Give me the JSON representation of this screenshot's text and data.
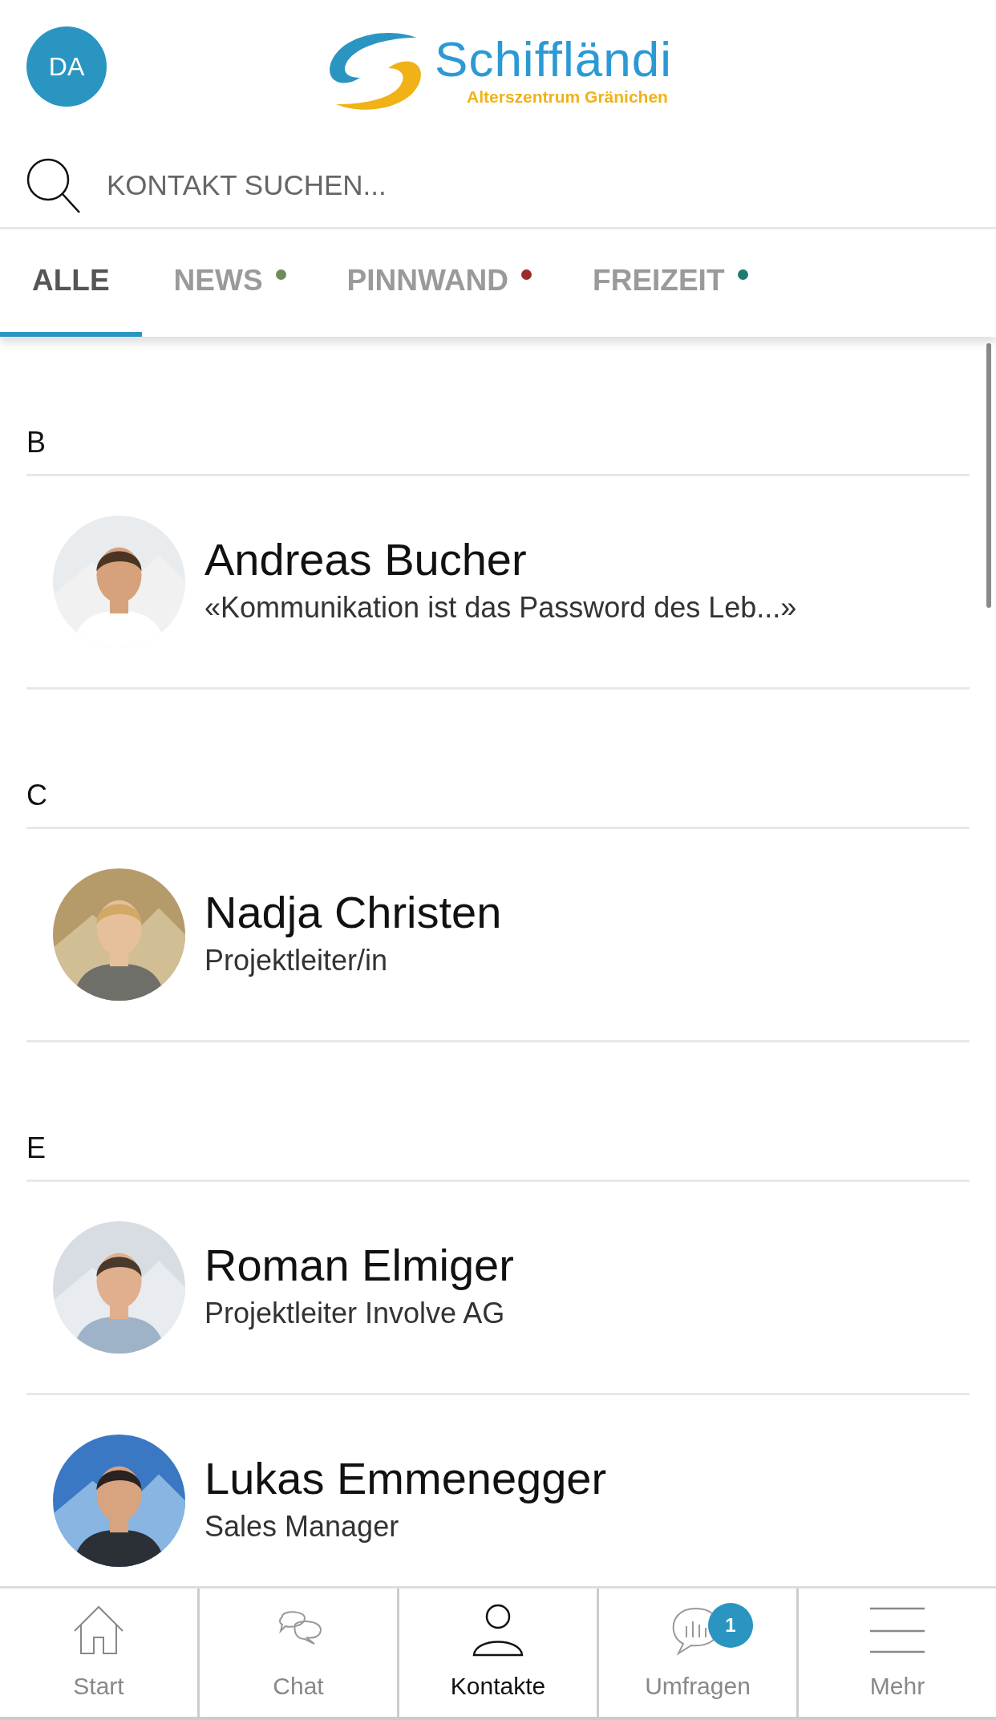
{
  "header": {
    "user_initials": "DA",
    "logo_title": "Schiffländi",
    "logo_subtitle": "Alterszentrum Gränichen"
  },
  "search": {
    "placeholder": "KONTAKT SUCHEN..."
  },
  "tabs": [
    {
      "label": "ALLE",
      "selected": true
    },
    {
      "label": "NEWS",
      "selected": false,
      "color": "#6e8c5a"
    },
    {
      "label": "PINNWAND",
      "selected": false,
      "color": "#9b2c2c"
    },
    {
      "label": "FREIZEIT",
      "selected": false,
      "color": "#1f7a73"
    }
  ],
  "sections": [
    {
      "letter": "B",
      "contacts": [
        {
          "name": "Andreas Bucher",
          "subtitle": "«Kommunikation ist das Password des Leb...»"
        }
      ]
    },
    {
      "letter": "C",
      "contacts": [
        {
          "name": "Nadja Christen",
          "subtitle": "Projektleiter/in"
        }
      ]
    },
    {
      "letter": "E",
      "contacts": [
        {
          "name": "Roman Elmiger",
          "subtitle": "Projektleiter Involve AG"
        },
        {
          "name": "Lukas Emmenegger",
          "subtitle": "Sales Manager"
        }
      ]
    }
  ],
  "bottom_nav": [
    {
      "label": "Start",
      "selected": false
    },
    {
      "label": "Chat",
      "selected": false
    },
    {
      "label": "Kontakte",
      "selected": true
    },
    {
      "label": "Umfragen",
      "selected": false,
      "badge": "1"
    },
    {
      "label": "Mehr",
      "selected": false
    }
  ]
}
